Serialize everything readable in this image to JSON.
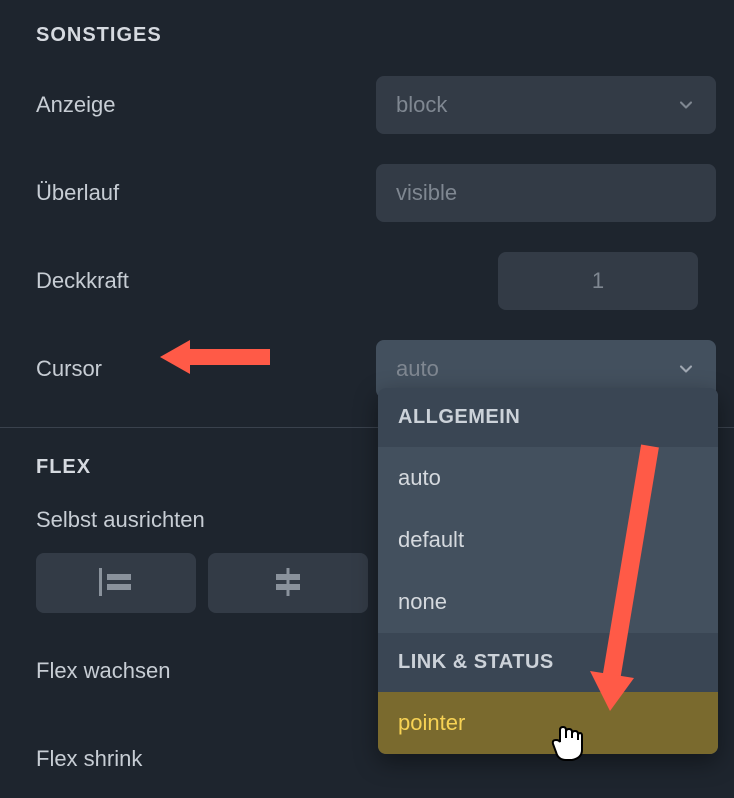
{
  "sections": {
    "misc": {
      "title": "SONSTIGES",
      "display_label": "Anzeige",
      "display_value": "block",
      "overflow_label": "Überlauf",
      "overflow_value": "visible",
      "opacity_label": "Deckkraft",
      "opacity_value": "1",
      "cursor_label": "Cursor",
      "cursor_value": "auto"
    },
    "flex": {
      "title": "FLEX",
      "align_self_label": "Selbst ausrichten",
      "flex_grow_label": "Flex wachsen",
      "flex_shrink_label": "Flex shrink"
    }
  },
  "dropdown": {
    "group1_heading": "ALLGEMEIN",
    "item_auto": "auto",
    "item_default": "default",
    "item_none": "none",
    "group2_heading": "LINK & STATUS",
    "item_pointer": "pointer"
  },
  "icons": {
    "chevron_down": "chevron-down-icon",
    "align_left": "align-left-icon",
    "align_center": "align-center-icon",
    "hand_cursor": "hand-cursor-icon"
  }
}
